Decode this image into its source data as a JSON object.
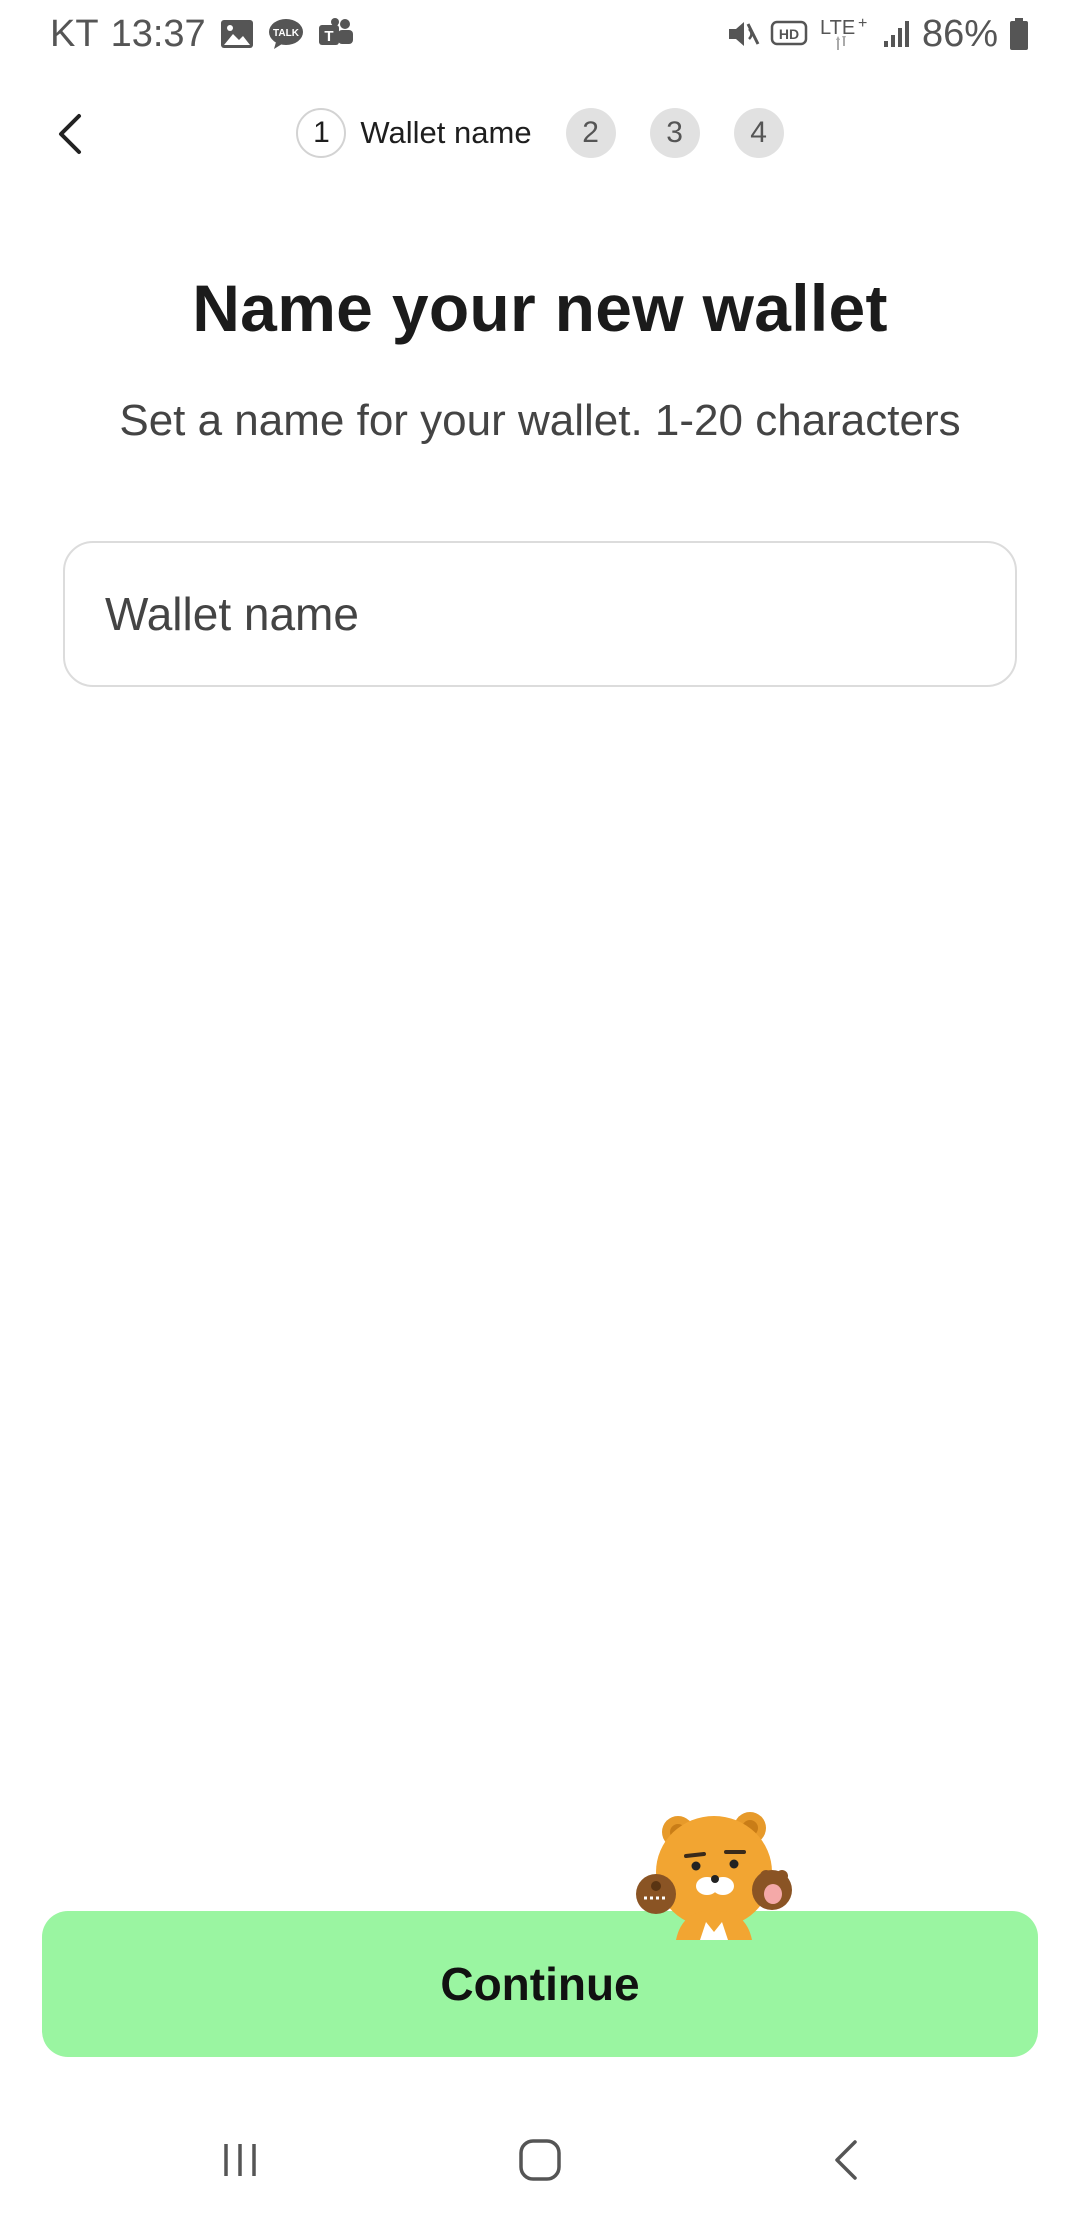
{
  "status_bar": {
    "carrier": "KT",
    "time": "13:37",
    "battery": "86%",
    "network": "LTE+",
    "left_icons": [
      "gallery-icon",
      "kakaotalk-icon",
      "teams-icon"
    ],
    "right_icons": [
      "mute-icon",
      "hd-voice-icon",
      "lte-icon",
      "signal-icon",
      "battery-icon"
    ]
  },
  "header": {
    "steps": [
      {
        "number": "1",
        "label": "Wallet name",
        "active": true
      },
      {
        "number": "2",
        "active": false
      },
      {
        "number": "3",
        "active": false
      },
      {
        "number": "4",
        "active": false
      }
    ]
  },
  "main": {
    "title": "Name your new wallet",
    "subtitle": "Set a name for your wallet. 1-20 characters",
    "name_input": {
      "placeholder": "Wallet name",
      "value": ""
    }
  },
  "footer": {
    "continue_label": "Continue",
    "mascot": "ryan-mascot"
  },
  "colors": {
    "primary_button": "#9af5a1",
    "text_primary": "#1b1b1b",
    "text_secondary": "#444444",
    "step_inactive": "#e1e1e1",
    "border": "#dcdcdc"
  },
  "nav_bar": {
    "buttons": [
      "recents-icon",
      "home-icon",
      "back-icon"
    ]
  }
}
